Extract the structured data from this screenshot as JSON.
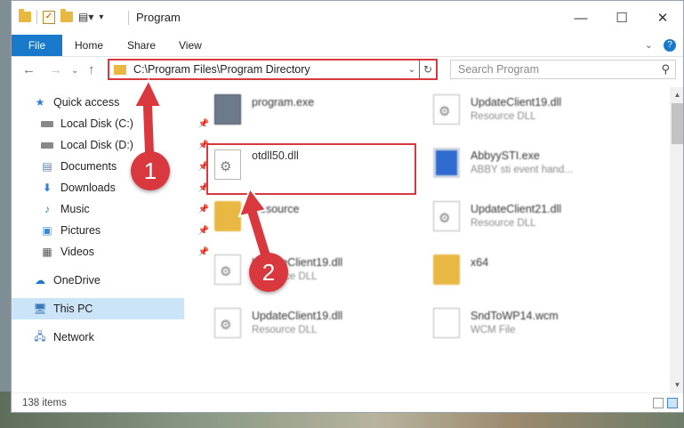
{
  "window": {
    "title": "Program",
    "controls": {
      "minimize": "—",
      "maximize": "☐",
      "close": "✕"
    }
  },
  "ribbon": {
    "tabs": [
      "File",
      "Home",
      "Share",
      "View"
    ],
    "expand": "⌄",
    "help": "?"
  },
  "address": {
    "path": "C:\\Program Files\\Program Directory",
    "search_placeholder": "Search Program"
  },
  "navigation": {
    "quick_access": "Quick access",
    "pinned": [
      {
        "label": "Local Disk (C:)",
        "icon": "drive-icon"
      },
      {
        "label": "Local Disk (D:)",
        "icon": "drive-icon"
      },
      {
        "label": "Documents",
        "icon": "documents-icon"
      },
      {
        "label": "Downloads",
        "icon": "downloads-icon"
      },
      {
        "label": "Music",
        "icon": "music-icon"
      },
      {
        "label": "Pictures",
        "icon": "pictures-icon"
      },
      {
        "label": "Videos",
        "icon": "videos-icon"
      }
    ],
    "onedrive": "OneDrive",
    "this_pc": "This PC",
    "network": "Network"
  },
  "files": [
    {
      "name": "program.exe",
      "type": "",
      "icon": "exe-icon"
    },
    {
      "name": "UpdateClient19.dll",
      "type": "Resource DLL",
      "icon": "dll-icon"
    },
    {
      "name": "otdll50.dll",
      "type": "",
      "icon": "dll-icon"
    },
    {
      "name": "AbbyySTI.exe",
      "type": "ABBY sti event hand...",
      "icon": "exe-icon"
    },
    {
      "name": "Resource",
      "type": "",
      "icon": "folder-icon"
    },
    {
      "name": "UpdateClient21.dll",
      "type": "Resource DLL",
      "icon": "dll-icon"
    },
    {
      "name": "UpdateClient19.dll",
      "type": "Resource DLL",
      "icon": "dll-icon"
    },
    {
      "name": "x64",
      "type": "",
      "icon": "folder-icon"
    },
    {
      "name": "UpdateClient19.dll",
      "type": "Resource DLL",
      "icon": "dll-icon"
    },
    {
      "name": "SndToWP14.wcm",
      "type": "WCM File",
      "icon": "file-icon"
    }
  ],
  "status": {
    "item_count": "138 items"
  },
  "annotations": {
    "step1": "1",
    "step2": "2",
    "accent": "#d9393e"
  }
}
